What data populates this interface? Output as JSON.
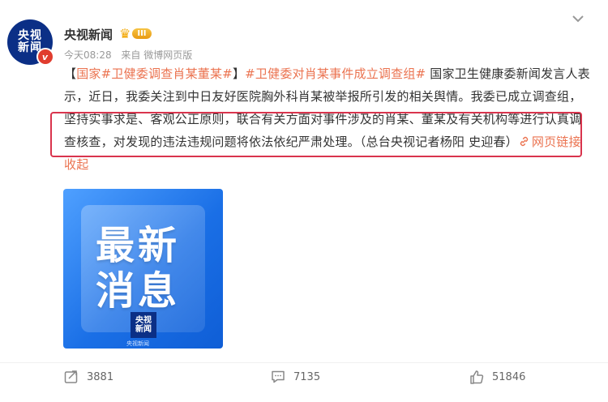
{
  "author": {
    "avatar_text_1": "央视",
    "avatar_text_2": "新闻",
    "verified_mark": "v",
    "name": "央视新闻",
    "level": "III"
  },
  "meta": {
    "time": "今天08:28",
    "source": "来自 微博网页版"
  },
  "post": {
    "bracket_open": "【",
    "tag1": "国家#卫健委调查肖某董某#",
    "bracket_close": "】",
    "tag2": "#卫健委对肖某事件成立调查组#",
    "text": " 国家卫生健康委新闻发言人表示，近日，我委关注到中日友好医院胸外科肖某被举报所引发的相关舆情。我委已成立调查组，坚持实事求是、客观公正原则，联合有关方面对事件涉及的肖某、董某及有关机构等进行认真调查核查，对发现的违法违规问题将依法依纪严肃处理。（总台央视记者杨阳 史迎春）",
    "link_label": "网页链接",
    "collapse_label": "收起"
  },
  "image": {
    "headline_1": "最新",
    "headline_2": "消息",
    "logo_1": "央视",
    "logo_2": "新闻",
    "caption": "央视新闻"
  },
  "actions": {
    "repost": "3881",
    "comment": "7135",
    "like": "51846"
  },
  "colors": {
    "accent": "#eb7350",
    "highlight_border": "#d9344d",
    "avatar_bg": "#0b2f86"
  }
}
